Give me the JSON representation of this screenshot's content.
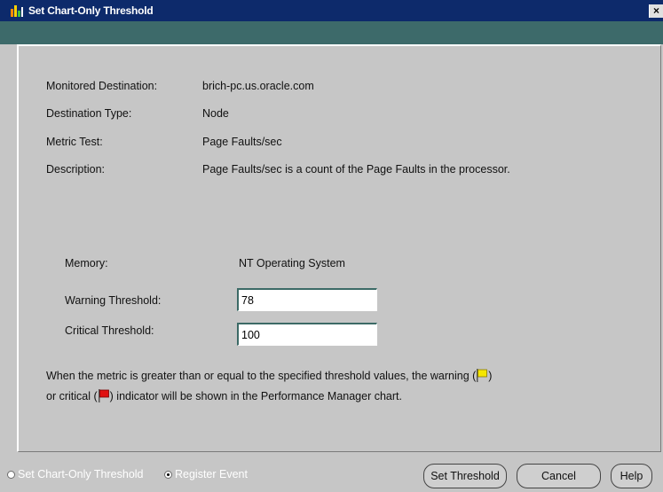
{
  "window": {
    "title": "Set Chart-Only Threshold",
    "close_glyph": "×"
  },
  "details": {
    "monitored_destination_label": "Monitored Destination:",
    "monitored_destination_value": "brich-pc.us.oracle.com",
    "destination_type_label": "Destination Type:",
    "destination_type_value": "Node",
    "metric_test_label": "Metric Test:",
    "metric_test_value": "Page Faults/sec",
    "description_label": "Description:",
    "description_value": "Page Faults/sec is a count of the Page Faults in the processor."
  },
  "thresholds": {
    "memory_label": "Memory:",
    "memory_value": "NT Operating System",
    "warning_label": "Warning Threshold:",
    "warning_value": "78",
    "critical_label": "Critical Threshold:",
    "critical_value": "100"
  },
  "note": {
    "line1_before": "When the metric is greater than or equal to the specified threshold values, the warning (",
    "line1_after": ")",
    "line2_before": "or critical (",
    "line2_after": ") indicator will be shown in the Performance Manager chart."
  },
  "footer": {
    "radio_set_chart_label": "Set Chart-Only Threshold",
    "radio_register_event_label": "Register Event",
    "selected_radio": "Register Event",
    "set_threshold_button": "Set Threshold",
    "cancel_button": "Cancel",
    "help_button": "Help"
  },
  "colors": {
    "titlebar": "#0d2a6b",
    "dialog_background": "#c6c6c6",
    "warning_flag": "#f5e600",
    "critical_flag": "#e01010"
  },
  "icons": [
    "chart-app-icon",
    "close-icon",
    "warning-flag-icon",
    "critical-flag-icon"
  ]
}
